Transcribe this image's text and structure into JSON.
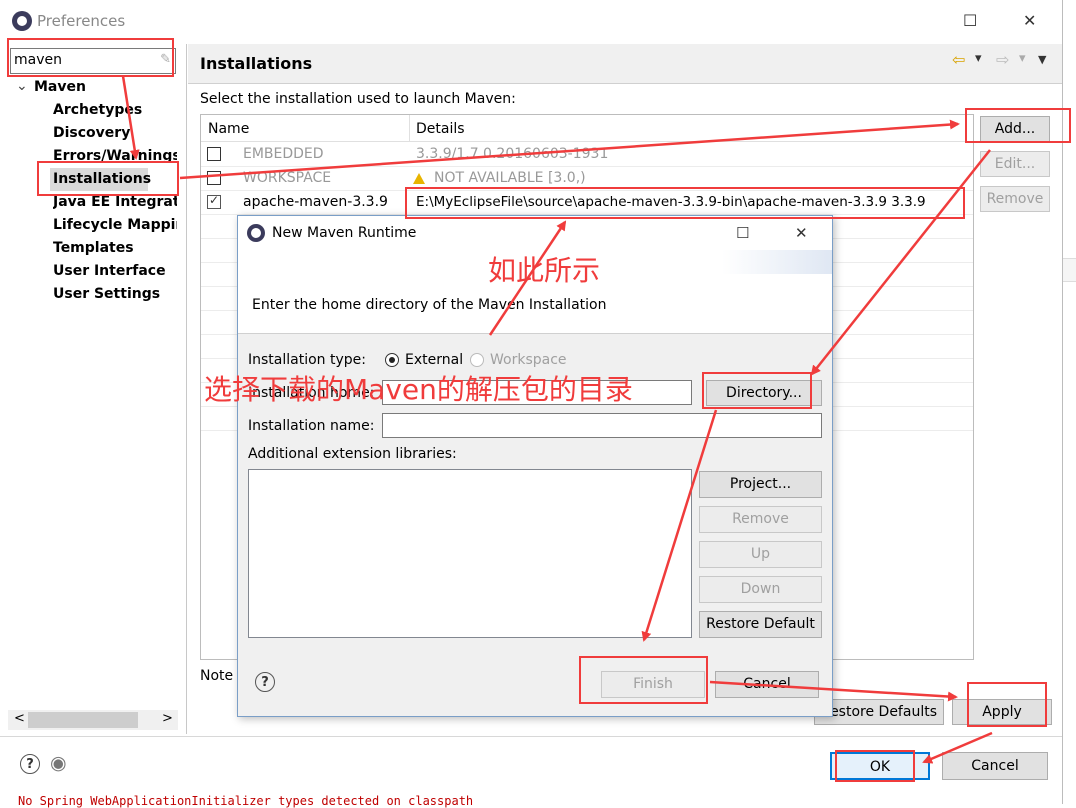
{
  "window": {
    "title": "Preferences",
    "maximize_glyph": "☐",
    "close_glyph": "✕"
  },
  "filter": {
    "value": "maven",
    "clear_glyph": "✎"
  },
  "tree": {
    "root": "Maven",
    "toggle_glyph": "⌄",
    "items": [
      "Archetypes",
      "Discovery",
      "Errors/Warnings",
      "Installations",
      "Java EE Integrati",
      "Lifecycle Mappir",
      "Templates",
      "User Interface",
      "User Settings"
    ]
  },
  "scroll_left": "<",
  "scroll_right": ">",
  "page": {
    "title": "Installations",
    "description": "Select the installation used to launch Maven:"
  },
  "history": {
    "back": "⇦",
    "forward": "⇨",
    "menu": "▾",
    "view_menu": "▼"
  },
  "table": {
    "headers": [
      "Name",
      "Details"
    ],
    "rows": [
      {
        "name": "EMBEDDED",
        "details": "3.3.9/1.7.0.20160603-1931",
        "checked": false
      },
      {
        "name": "WORKSPACE",
        "details": "NOT AVAILABLE [3.0,)",
        "checked": false
      },
      {
        "name": "apache-maven-3.3.9",
        "details": "E:\\MyEclipseFile\\source\\apache-maven-3.3.9-bin\\apache-maven-3.3.9 3.3.9",
        "checked": true
      }
    ]
  },
  "side_buttons": {
    "add": "Add...",
    "edit": "Edit...",
    "remove": "Remove"
  },
  "note_label": "Note",
  "restore_defaults": "Restore Defaults",
  "apply": "Apply",
  "ok": "OK",
  "cancel": "Cancel",
  "bottom_icons": {
    "help": "?",
    "prefs": "◉"
  },
  "status_text": "No Spring WebApplicationInitializer types detected on classpath",
  "dialog": {
    "title": "New Maven Runtime",
    "maximize_glyph": "☐",
    "close_glyph": "✕",
    "message": "Enter the home directory of the Maven Installation",
    "installation_type_label": "Installation type:",
    "external": "External",
    "workspace": "Workspace",
    "home_label": "Installation home:",
    "home_value": "",
    "directory_button": "Directory...",
    "name_label": "Installation name:",
    "name_value": "",
    "libraries_label": "Additional extension libraries:",
    "buttons": {
      "project": "Project...",
      "remove": "Remove",
      "up": "Up",
      "down": "Down",
      "restore_default": "Restore Default"
    },
    "finish": "Finish",
    "cancel": "Cancel",
    "help": "?"
  },
  "annotations": {
    "note1": "如此所示",
    "note2": "选择下载的Maven的解压包的目录"
  },
  "colors": {
    "annotation": "#f03c3c",
    "selection": "#dadada",
    "ok_border": "#0078d7"
  }
}
